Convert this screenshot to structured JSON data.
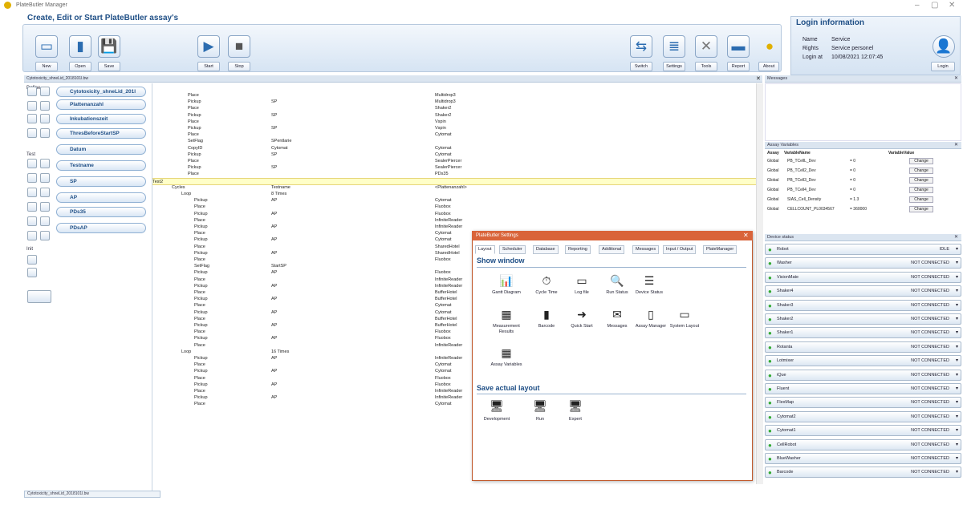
{
  "window": {
    "title": "PlateButler Manager",
    "heading": "Create, Edit or Start PlateButler assay's"
  },
  "toolbar": {
    "new": "New",
    "open": "Open",
    "save": "Save",
    "start": "Start",
    "stop": "Stop",
    "switch": "Switch",
    "settings": "Settings",
    "tools": "Tools",
    "report": "Report",
    "about": "About"
  },
  "login": {
    "title": "Login information",
    "name_label": "Name",
    "name_value": "Service",
    "rights_label": "Rights",
    "rights_value": "Service personel",
    "login_label": "Login at",
    "login_value": "10/08/2021 12:07:45",
    "button": "Login"
  },
  "document_tab": "Cytotoxicity_shneLid_2018101l.bw",
  "bottom_tab": "Cytotoxicity_shneLid_2018101l.bw",
  "left": {
    "define": "Define",
    "test": "Test",
    "init": "Init",
    "pills": [
      "Cytotoxicity_shneLid_201l",
      "Plattenanzahl",
      "Inkubationszeit",
      "ThresBeforeStartSP",
      "Datum",
      "Testname",
      "SP",
      "AP",
      "PDs35",
      "PDsAP"
    ]
  },
  "sequence": [
    {
      "action": "Place",
      "param": "",
      "target": "Multidrop3"
    },
    {
      "action": "Pickup",
      "param": "SP",
      "target": "Multidrop3"
    },
    {
      "action": "Place",
      "param": "",
      "target": "Shaker2"
    },
    {
      "action": "Pickup",
      "param": "SP",
      "target": "Shaker2"
    },
    {
      "action": "Place",
      "param": "",
      "target": "Vspin"
    },
    {
      "action": "Pickup",
      "param": "SP",
      "target": "Vspin"
    },
    {
      "action": "Place",
      "param": "",
      "target": "Cytomat"
    },
    {
      "action": "SetFlag",
      "param": "SPentlarie",
      "target": ""
    },
    {
      "action": "CopyID",
      "param": "Cytomat",
      "target": "Cytomat"
    },
    {
      "action": "Pickup",
      "param": "SP",
      "target": "Cytomat"
    },
    {
      "action": "Place",
      "param": "",
      "target": "SealerPiercer"
    },
    {
      "action": "Pickup",
      "param": "SP",
      "target": "SealerPiercer"
    },
    {
      "action": "Place",
      "param": "",
      "target": "PDs35"
    },
    {
      "action": "Test2",
      "param": "",
      "target": ""
    },
    {
      "action": "Cycles",
      "param": "Testname",
      "target": "<Plattenanzahl>"
    },
    {
      "action": "Loop",
      "param": "8 Times",
      "target": ""
    },
    {
      "action": "Pickup",
      "param": "AP",
      "target": "Cytomat"
    },
    {
      "action": "Place",
      "param": "",
      "target": "Fluobox"
    },
    {
      "action": "Pickup",
      "param": "AP",
      "target": "Fluobox"
    },
    {
      "action": "Place",
      "param": "",
      "target": "InfiniteReader"
    },
    {
      "action": "Pickup",
      "param": "AP",
      "target": "InfiniteReader"
    },
    {
      "action": "Place",
      "param": "",
      "target": "Cytomat"
    },
    {
      "action": "Pickup",
      "param": "AP",
      "target": "Cytomat"
    },
    {
      "action": "Place",
      "param": "",
      "target": "SharedHotel"
    },
    {
      "action": "Pickup",
      "param": "AP",
      "target": "SharedHotel"
    },
    {
      "action": "Place",
      "param": "",
      "target": "Fluobox"
    },
    {
      "action": "SetFlag",
      "param": "StartSP",
      "target": ""
    },
    {
      "action": "Pickup",
      "param": "AP",
      "target": "Fluobox"
    },
    {
      "action": "Place",
      "param": "",
      "target": "InfiniteReader"
    },
    {
      "action": "Pickup",
      "param": "AP",
      "target": "InfiniteReader"
    },
    {
      "action": "Place",
      "param": "",
      "target": "BufferHotel"
    },
    {
      "action": "Pickup",
      "param": "AP",
      "target": "BufferHotel"
    },
    {
      "action": "Place",
      "param": "",
      "target": "Cytomat"
    },
    {
      "action": "Pickup",
      "param": "AP",
      "target": "Cytomat"
    },
    {
      "action": "Place",
      "param": "",
      "target": "BufferHotel"
    },
    {
      "action": "Pickup",
      "param": "AP",
      "target": "BufferHotel"
    },
    {
      "action": "Place",
      "param": "",
      "target": "Fluobox"
    },
    {
      "action": "Pickup",
      "param": "AP",
      "target": "Fluobox"
    },
    {
      "action": "Place",
      "param": "",
      "target": "InfiniteReader"
    },
    {
      "action": "Loop",
      "param": "16 Times",
      "target": ""
    },
    {
      "action": "Pickup",
      "param": "AP",
      "target": "InfiniteReader"
    },
    {
      "action": "Place",
      "param": "",
      "target": "Cytomat"
    },
    {
      "action": "Pickup",
      "param": "AP",
      "target": "Cytomat"
    },
    {
      "action": "Place",
      "param": "",
      "target": "Fluobox"
    },
    {
      "action": "Pickup",
      "param": "AP",
      "target": "Fluobox"
    },
    {
      "action": "Place",
      "param": "",
      "target": "InfiniteReader"
    },
    {
      "action": "Pickup",
      "param": "AP",
      "target": "InfiniteReader"
    },
    {
      "action": "Place",
      "param": "",
      "target": "Cytomat"
    }
  ],
  "dialog": {
    "title": "PlateButler Settings",
    "tabs": [
      "Layout",
      "Scheduler",
      "Database",
      "Reporting",
      "Additional",
      "Messages",
      "Input / Output",
      "PlateManager"
    ],
    "section1": "Show window",
    "section2": "Save actual layout",
    "items": [
      "Gantt Diagram",
      "Cycle Time",
      "Log file",
      "Run Status",
      "Device Status",
      "Measurement Results",
      "Barcode",
      "Quick Start",
      "Messages",
      "Assay Manager",
      "System Layout",
      "Assay Variables"
    ],
    "layouts": [
      "Development",
      "Run",
      "Expert"
    ]
  },
  "messages": {
    "title": "Messages"
  },
  "assay_vars": {
    "title": "Assay Variables",
    "headers": [
      "Assay",
      "VariableName",
      "VariableValue"
    ],
    "change": "Change",
    "rows": [
      [
        "Global",
        "PB_TCellL_Dev",
        "= 0"
      ],
      [
        "Global",
        "PB_TCell2_Dev",
        "= 0"
      ],
      [
        "Global",
        "PB_TCell3_Dev",
        "= 0"
      ],
      [
        "Global",
        "PB_TCell4_Dev",
        "= 0"
      ],
      [
        "Global",
        "SIAS_Cell_Density",
        "= 1.3"
      ],
      [
        "Global",
        "CELLCOUNT_PL0034567",
        "= 360000"
      ]
    ]
  },
  "device_status": {
    "title": "Device status",
    "devices": [
      [
        "Robot",
        "IDLE"
      ],
      [
        "Washer",
        "NOT CONNECTED"
      ],
      [
        "VisionMate",
        "NOT CONNECTED"
      ],
      [
        "Shaker4",
        "NOT CONNECTED"
      ],
      [
        "Shaker3",
        "NOT CONNECTED"
      ],
      [
        "Shaker2",
        "NOT CONNECTED"
      ],
      [
        "Shaker1",
        "NOT CONNECTED"
      ],
      [
        "Rotanta",
        "NOT CONNECTED"
      ],
      [
        "Lotmixer",
        "NOT CONNECTED"
      ],
      [
        "iQue",
        "NOT CONNECTED"
      ],
      [
        "Fluent",
        "NOT CONNECTED"
      ],
      [
        "FlexMap",
        "NOT CONNECTED"
      ],
      [
        "Cytomat2",
        "NOT CONNECTED"
      ],
      [
        "Cytomat1",
        "NOT CONNECTED"
      ],
      [
        "CellRobot",
        "NOT CONNECTED"
      ],
      [
        "BlueWasher",
        "NOT CONNECTED"
      ],
      [
        "Barcode",
        "NOT CONNECTED"
      ]
    ]
  }
}
